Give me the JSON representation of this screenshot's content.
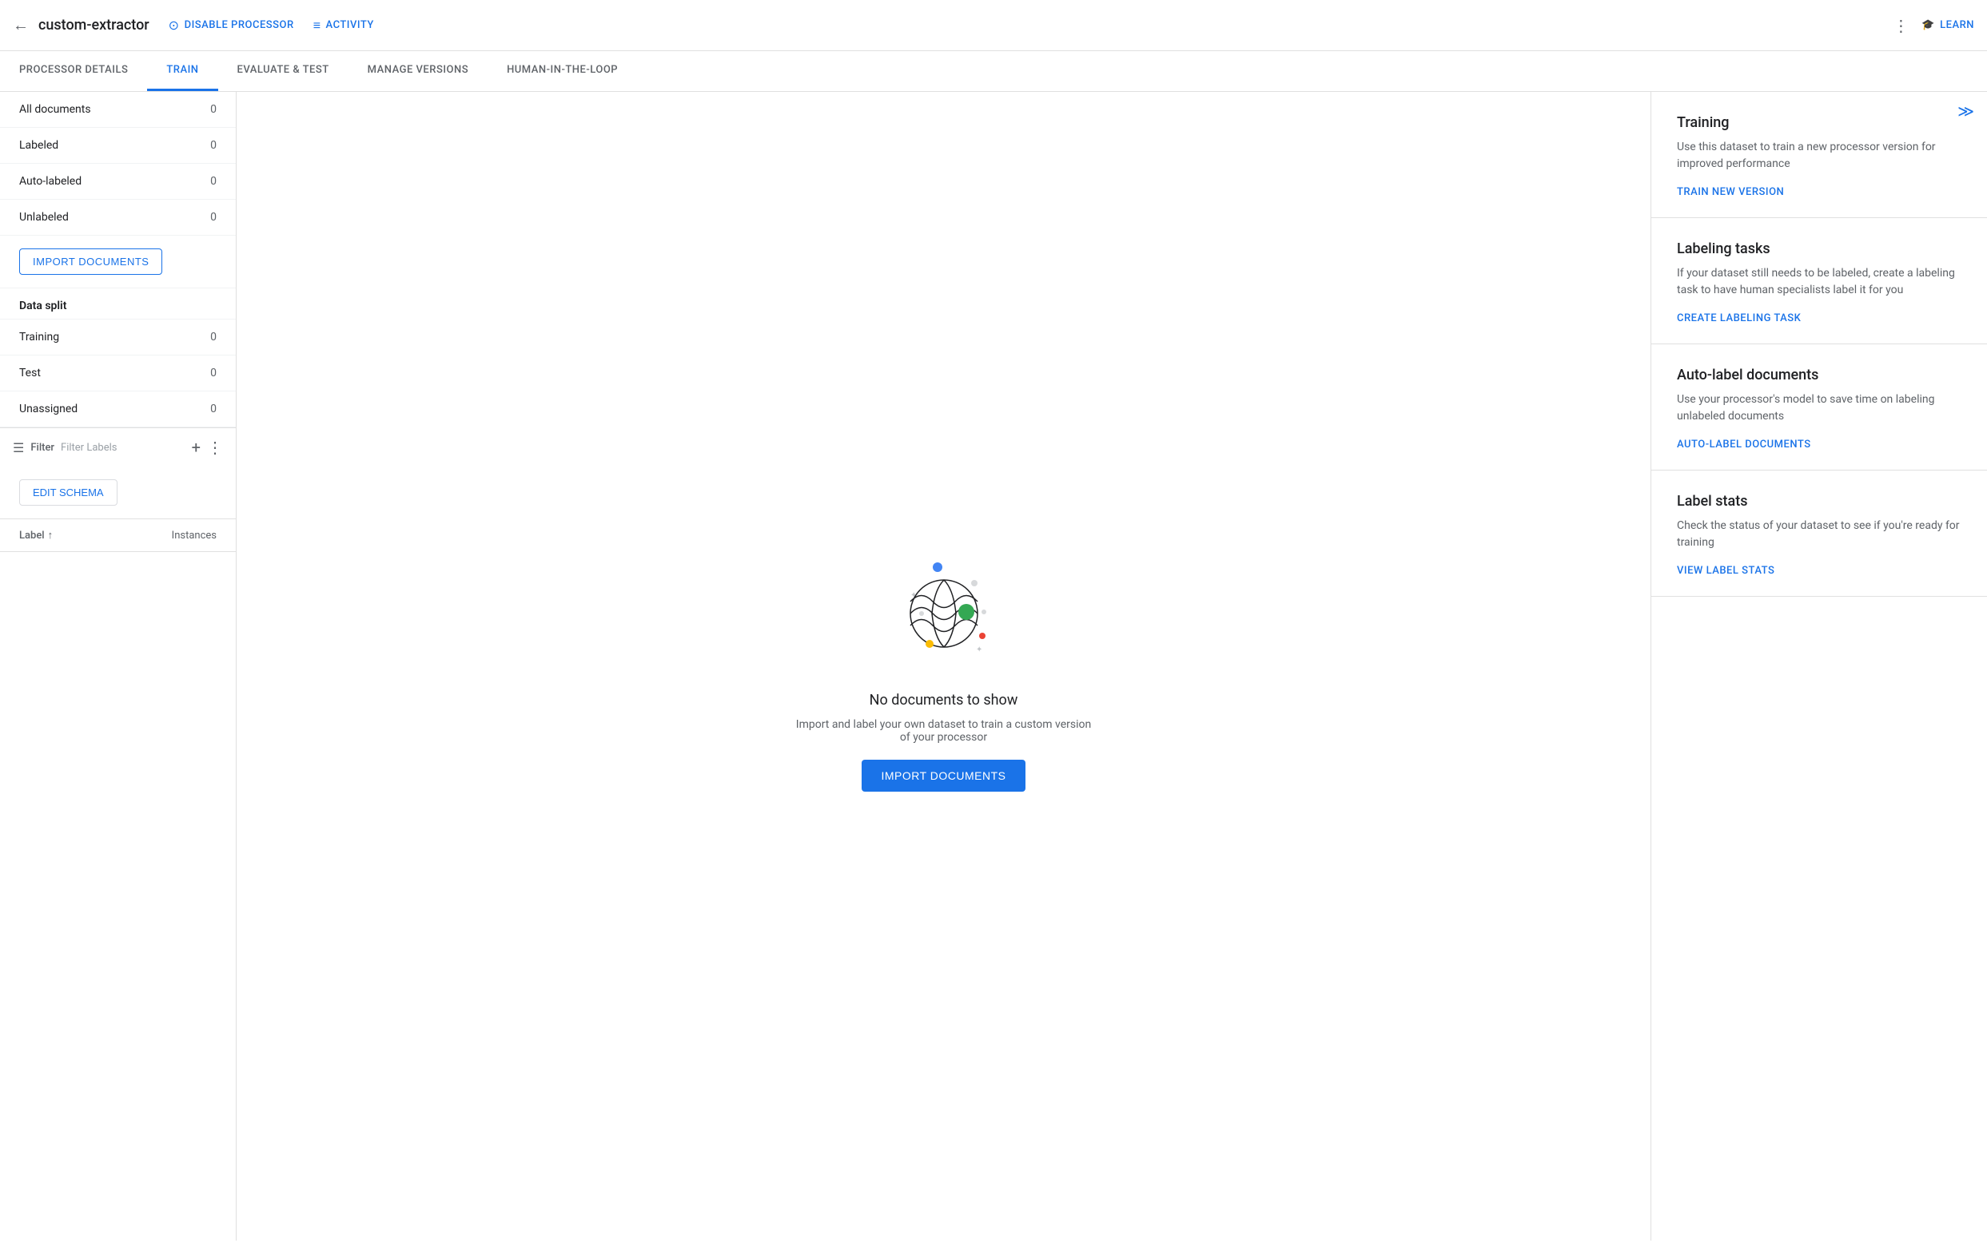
{
  "header": {
    "back_icon": "←",
    "title": "custom-extractor",
    "disable_processor_label": "DISABLE PROCESSOR",
    "activity_label": "ACTIVITY",
    "more_icon": "⋮",
    "learn_label": "LEARN"
  },
  "tabs": [
    {
      "id": "processor-details",
      "label": "PROCESSOR DETAILS",
      "active": false
    },
    {
      "id": "train",
      "label": "TRAIN",
      "active": true
    },
    {
      "id": "evaluate-test",
      "label": "EVALUATE & TEST",
      "active": false
    },
    {
      "id": "manage-versions",
      "label": "MANAGE VERSIONS",
      "active": false
    },
    {
      "id": "human-in-the-loop",
      "label": "HUMAN-IN-THE-LOOP",
      "active": false
    }
  ],
  "sidebar": {
    "all_documents_label": "All documents",
    "all_documents_count": "0",
    "labeled_label": "Labeled",
    "labeled_count": "0",
    "auto_labeled_label": "Auto-labeled",
    "auto_labeled_count": "0",
    "unlabeled_label": "Unlabeled",
    "unlabeled_count": "0",
    "import_btn_label": "IMPORT DOCUMENTS",
    "data_split_label": "Data split",
    "training_label": "Training",
    "training_count": "0",
    "test_label": "Test",
    "test_count": "0",
    "unassigned_label": "Unassigned",
    "unassigned_count": "0",
    "filter_label": "Filter",
    "filter_placeholder": "Filter Labels",
    "edit_schema_btn": "EDIT SCHEMA",
    "label_col": "Label",
    "instances_col": "Instances",
    "sort_icon": "↑"
  },
  "main": {
    "empty_title": "No documents to show",
    "empty_subtitle": "Import and label your own dataset to train a custom version of your processor",
    "import_btn_label": "IMPORT DOCUMENTS"
  },
  "right_panel": {
    "collapse_icon": "≫",
    "sections": [
      {
        "id": "training",
        "title": "Training",
        "description": "Use this dataset to train a new processor version for improved performance",
        "link_label": "TRAIN NEW VERSION"
      },
      {
        "id": "labeling-tasks",
        "title": "Labeling tasks",
        "description": "If your dataset still needs to be labeled, create a labeling task to have human specialists label it for you",
        "link_label": "CREATE LABELING TASK"
      },
      {
        "id": "auto-label",
        "title": "Auto-label documents",
        "description": "Use your processor's model to save time on labeling unlabeled documents",
        "link_label": "AUTO-LABEL DOCUMENTS"
      },
      {
        "id": "label-stats",
        "title": "Label stats",
        "description": "Check the status of your dataset to see if you're ready for training",
        "link_label": "VIEW LABEL STATS"
      }
    ]
  }
}
